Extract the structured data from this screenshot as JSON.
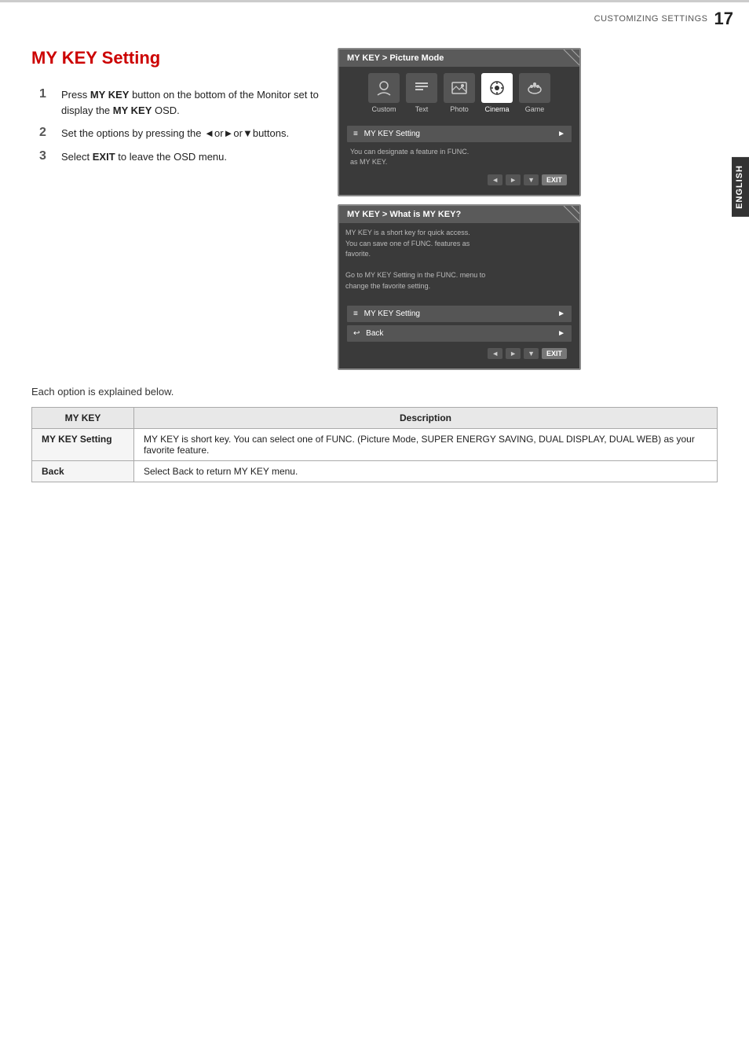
{
  "header": {
    "section_label": "CUSTOMIZING SETTINGS",
    "page_number": "17"
  },
  "side_tab": {
    "label": "ENGLISH"
  },
  "page_title": "MY KEY Setting",
  "instructions": [
    {
      "number": "1",
      "text_parts": [
        {
          "type": "normal",
          "text": "Press "
        },
        {
          "type": "bold",
          "text": "MY KEY"
        },
        {
          "type": "normal",
          "text": " button on the bottom of the Monitor set to display the "
        },
        {
          "type": "bold",
          "text": "MY KEY"
        },
        {
          "type": "normal",
          "text": " OSD."
        }
      ]
    },
    {
      "number": "2",
      "text_parts": [
        {
          "type": "normal",
          "text": "Set the options by pressing the ◄or►or▼buttons."
        }
      ]
    },
    {
      "number": "3",
      "text_parts": [
        {
          "type": "normal",
          "text": "Select "
        },
        {
          "type": "bold",
          "text": "EXIT"
        },
        {
          "type": "normal",
          "text": " to leave the OSD menu."
        }
      ]
    }
  ],
  "osd1": {
    "header": "MY KEY  >  Picture Mode",
    "icons": [
      {
        "label": "Custom",
        "symbol": "👤",
        "selected": false
      },
      {
        "label": "Text",
        "symbol": "📄",
        "selected": false
      },
      {
        "label": "Photo",
        "symbol": "🖼",
        "selected": false
      },
      {
        "label": "Cinema",
        "symbol": "⚙",
        "selected": false
      },
      {
        "label": "Game",
        "symbol": "🎮",
        "selected": false
      }
    ],
    "menu_item": "MY KEY Setting",
    "desc_text": "You can designate a feature in FUNC.\nas MY KEY.",
    "nav_left": "◄",
    "nav_right": "►",
    "nav_down": "▼",
    "exit_label": "EXIT"
  },
  "osd2": {
    "header": "MY KEY  >  What is MY KEY?",
    "content_line1": "MY KEY is a short key for quick access.",
    "content_line2": "You can save one of FUNC. features as",
    "content_line3": "favorite.",
    "content_line4": "",
    "content_line5": "Go to MY KEY Setting in the FUNC. menu to",
    "content_line6": "change the favorite setting.",
    "menu_item1": "MY KEY Setting",
    "menu_item2": "Back",
    "nav_left": "◄",
    "nav_right": "►",
    "nav_down": "▼",
    "exit_label": "EXIT"
  },
  "each_option_text": "Each option is explained below.",
  "table": {
    "col1_header": "MY KEY",
    "col2_header": "Description",
    "rows": [
      {
        "key": "MY KEY Setting",
        "description": "MY KEY is short key. You can select one of FUNC. (Picture Mode, SUPER ENERGY SAVING, DUAL DISPLAY, DUAL WEB) as your favorite feature."
      },
      {
        "key": "Back",
        "description": "Select Back to return MY KEY menu."
      }
    ]
  }
}
